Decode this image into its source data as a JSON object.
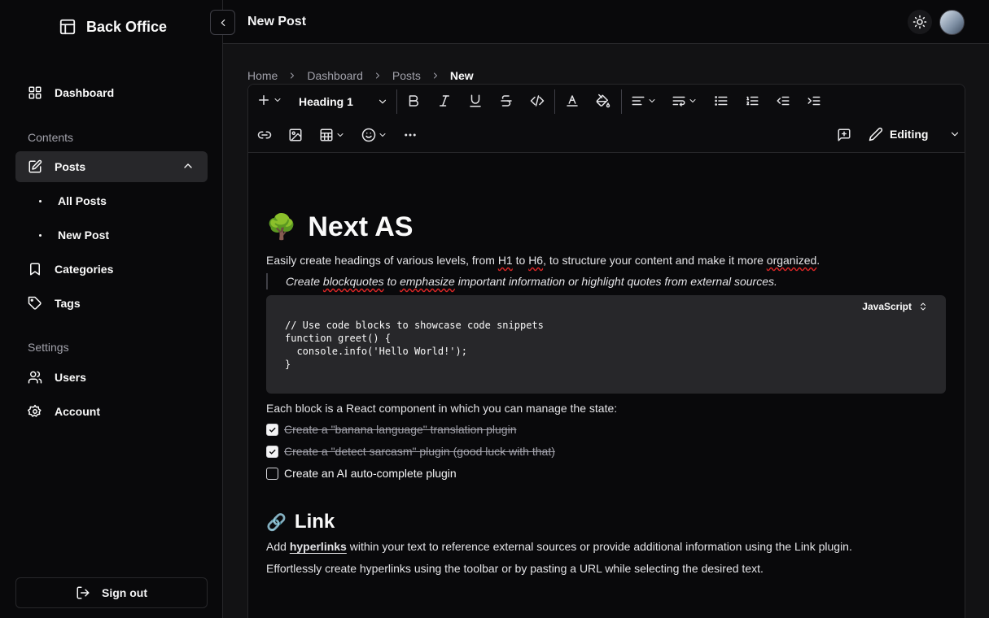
{
  "sidebar": {
    "brand": "Back Office",
    "dashboard": "Dashboard",
    "contents_label": "Contents",
    "posts": "Posts",
    "all_posts": "All Posts",
    "new_post": "New Post",
    "categories": "Categories",
    "tags": "Tags",
    "settings_label": "Settings",
    "users": "Users",
    "account": "Account",
    "sign_out": "Sign out"
  },
  "header": {
    "title": "New Post"
  },
  "breadcrumb": [
    "Home",
    "Dashboard",
    "Posts",
    "New"
  ],
  "toolbar": {
    "heading_select": "Heading 1",
    "mode": "Editing"
  },
  "document": {
    "title_emoji": "🌳",
    "title": "Next AS",
    "intro_a": "Easily create headings of various levels, from ",
    "intro_h1": "H1",
    "intro_to": " to ",
    "intro_h6": "H6",
    "intro_b": ", to structure your content and make it more ",
    "intro_organized": "organized",
    "intro_c": ".",
    "quote_a": "Create ",
    "quote_blockquotes": "blockquotes",
    "quote_to": " to ",
    "quote_emphasize": "emphasize",
    "quote_b": " important information or highlight quotes from external sources.",
    "code_language": "JavaScript",
    "code": "// Use code blocks to showcase code snippets\nfunction greet() {\n  console.info('Hello World!');\n}",
    "state_text": "Each block is a React component in which you can manage the state:",
    "todos": [
      {
        "text": "Create a \"banana language\" translation plugin",
        "checked": true
      },
      {
        "text": "Create a \"detect sarcasm\" plugin (good luck with that)",
        "checked": true
      },
      {
        "text": "Create an AI auto-complete plugin",
        "checked": false
      }
    ],
    "link_emoji": "🔗",
    "link_title": "Link",
    "link_p1_a": "Add ",
    "link_p1_link": "hyperlinks",
    "link_p1_b": " within your text to reference external sources or provide additional information using the Link plugin.",
    "link_p2": "Effortlessly create hyperlinks using the toolbar or by pasting a URL while selecting the desired text."
  }
}
